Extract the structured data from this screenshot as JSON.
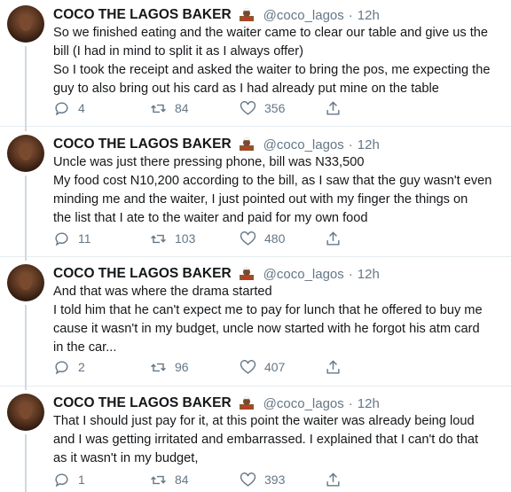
{
  "author": {
    "name": "COCO THE LAGOS BAKER",
    "handle": "@coco_lagos",
    "separator": "·"
  },
  "tweets": [
    {
      "time": "12h",
      "lines": [
        "So we finished eating and the waiter came to clear our table and give us the",
        "bill (I had in mind to split it as I always offer)",
        "So I took the receipt and asked the waiter to bring the pos, me expecting the",
        "guy to also bring out his card as I had already put mine on the table"
      ],
      "replies": "4",
      "retweets": "84",
      "likes": "356"
    },
    {
      "time": "12h",
      "lines": [
        "Uncle was just there pressing phone, bill was N33,500",
        "My food cost N10,200 according to the bill, as I saw that the guy wasn't even",
        "minding me and the waiter, I just pointed out with my finger the things on",
        "the list that I ate to the waiter and paid for my own food"
      ],
      "replies": "11",
      "retweets": "103",
      "likes": "480"
    },
    {
      "time": "12h",
      "lines": [
        "And that was where the drama started",
        "I told him that he can't expect me to pay for lunch that he offered to buy me",
        "cause it wasn't in my budget, uncle now started with he forgot his atm card",
        "in the car..."
      ],
      "replies": "2",
      "retweets": "96",
      "likes": "407"
    },
    {
      "time": "12h",
      "lines": [
        "That I should just pay for it, at this point the waiter was already being loud",
        "and I was getting irritated and embarrassed. I explained that I can't do that",
        "as it wasn't in my budget,"
      ],
      "replies": "1",
      "retweets": "84",
      "likes": "393"
    }
  ],
  "icons": {
    "reply": "reply-icon",
    "retweet": "retweet-icon",
    "like": "heart-icon",
    "share": "share-icon",
    "emoji": "baker-emoji"
  },
  "colors": {
    "text": "#14171a",
    "secondary": "#657786",
    "divider": "#e6ecf0"
  }
}
